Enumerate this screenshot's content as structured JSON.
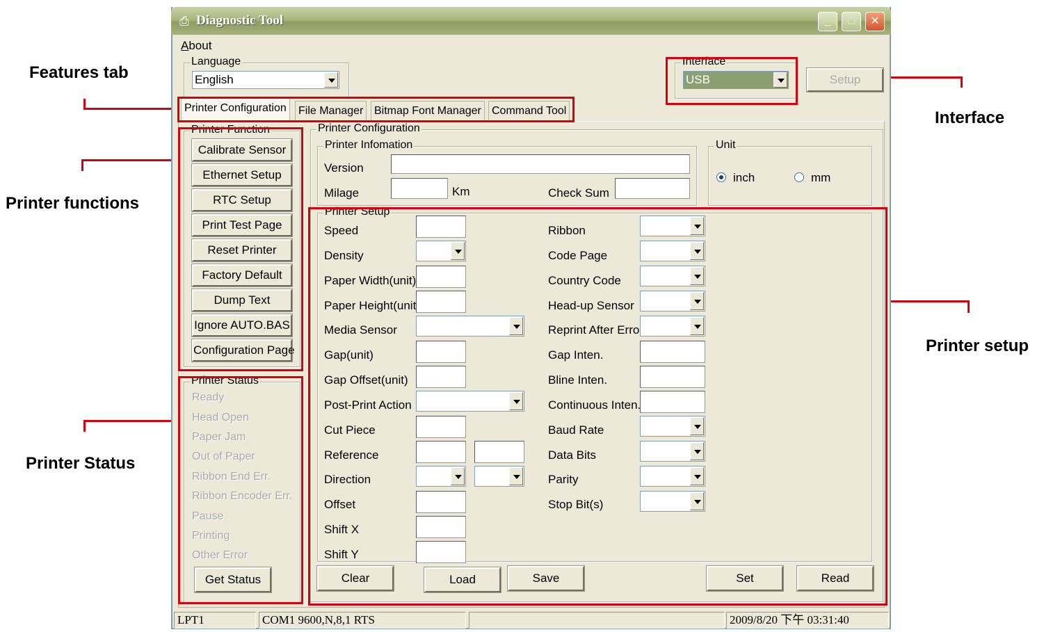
{
  "callouts": {
    "features_tab": "Features tab",
    "printer_functions": "Printer functions",
    "printer_status": "Printer Status",
    "interface": "Interface",
    "printer_setup": "Printer setup"
  },
  "window": {
    "title": "Diagnostic Tool",
    "menu": {
      "about": "bout",
      "about_accel": "A"
    }
  },
  "language": {
    "group": "Language",
    "value": "English"
  },
  "interface": {
    "group": "Interface",
    "value": "USB",
    "setup_button": "Setup"
  },
  "tabs": [
    "Printer Configuration",
    "File Manager",
    "Bitmap Font Manager",
    "Command Tool"
  ],
  "printer_function": {
    "group": "Printer Function",
    "buttons": [
      "Calibrate Sensor",
      "Ethernet Setup",
      "RTC Setup",
      "Print Test Page",
      "Reset Printer",
      "Factory Default",
      "Dump Text",
      "Ignore AUTO.BAS",
      "Configuration Page"
    ]
  },
  "printer_status": {
    "group": "Printer Status",
    "items": [
      "Ready",
      "Head Open",
      "Paper Jam",
      "Out of Paper",
      "Ribbon End Err.",
      "Ribbon Encoder Err.",
      "Pause",
      "Printing",
      "Other Error"
    ],
    "get_status": "Get Status"
  },
  "printer_configuration": {
    "group": "Printer Configuration",
    "info_group": "Printer Infomation",
    "version": "Version",
    "milage": "Milage",
    "km": "Km",
    "check_sum": "Check Sum",
    "unit_group": "Unit",
    "unit_inch": "inch",
    "unit_mm": "mm",
    "unit_selected": "inch"
  },
  "printer_setup": {
    "group": "Printer Setup",
    "left": [
      "Speed",
      "Density",
      "Paper Width(unit)",
      "Paper Height(unit)",
      "Media Sensor",
      "Gap(unit)",
      "Gap Offset(unit)",
      "Post-Print Action",
      "Cut Piece",
      "Reference",
      "Direction",
      "Offset",
      "Shift X",
      "Shift Y"
    ],
    "right": [
      "Ribbon",
      "Code Page",
      "Country Code",
      "Head-up Sensor",
      "Reprint After Error",
      "Gap Inten.",
      "Bline Inten.",
      "Continuous Inten.",
      "Baud Rate",
      "Data Bits",
      "Parity",
      "Stop Bit(s)"
    ]
  },
  "actions": {
    "clear": "Clear",
    "load": "Load",
    "save": "Save",
    "set": "Set",
    "read": "Read"
  },
  "statusbar": {
    "port": "LPT1",
    "com": "COM1 9600,N,8,1 RTS",
    "datetime": "2009/8/20 下午 03:31:40"
  }
}
